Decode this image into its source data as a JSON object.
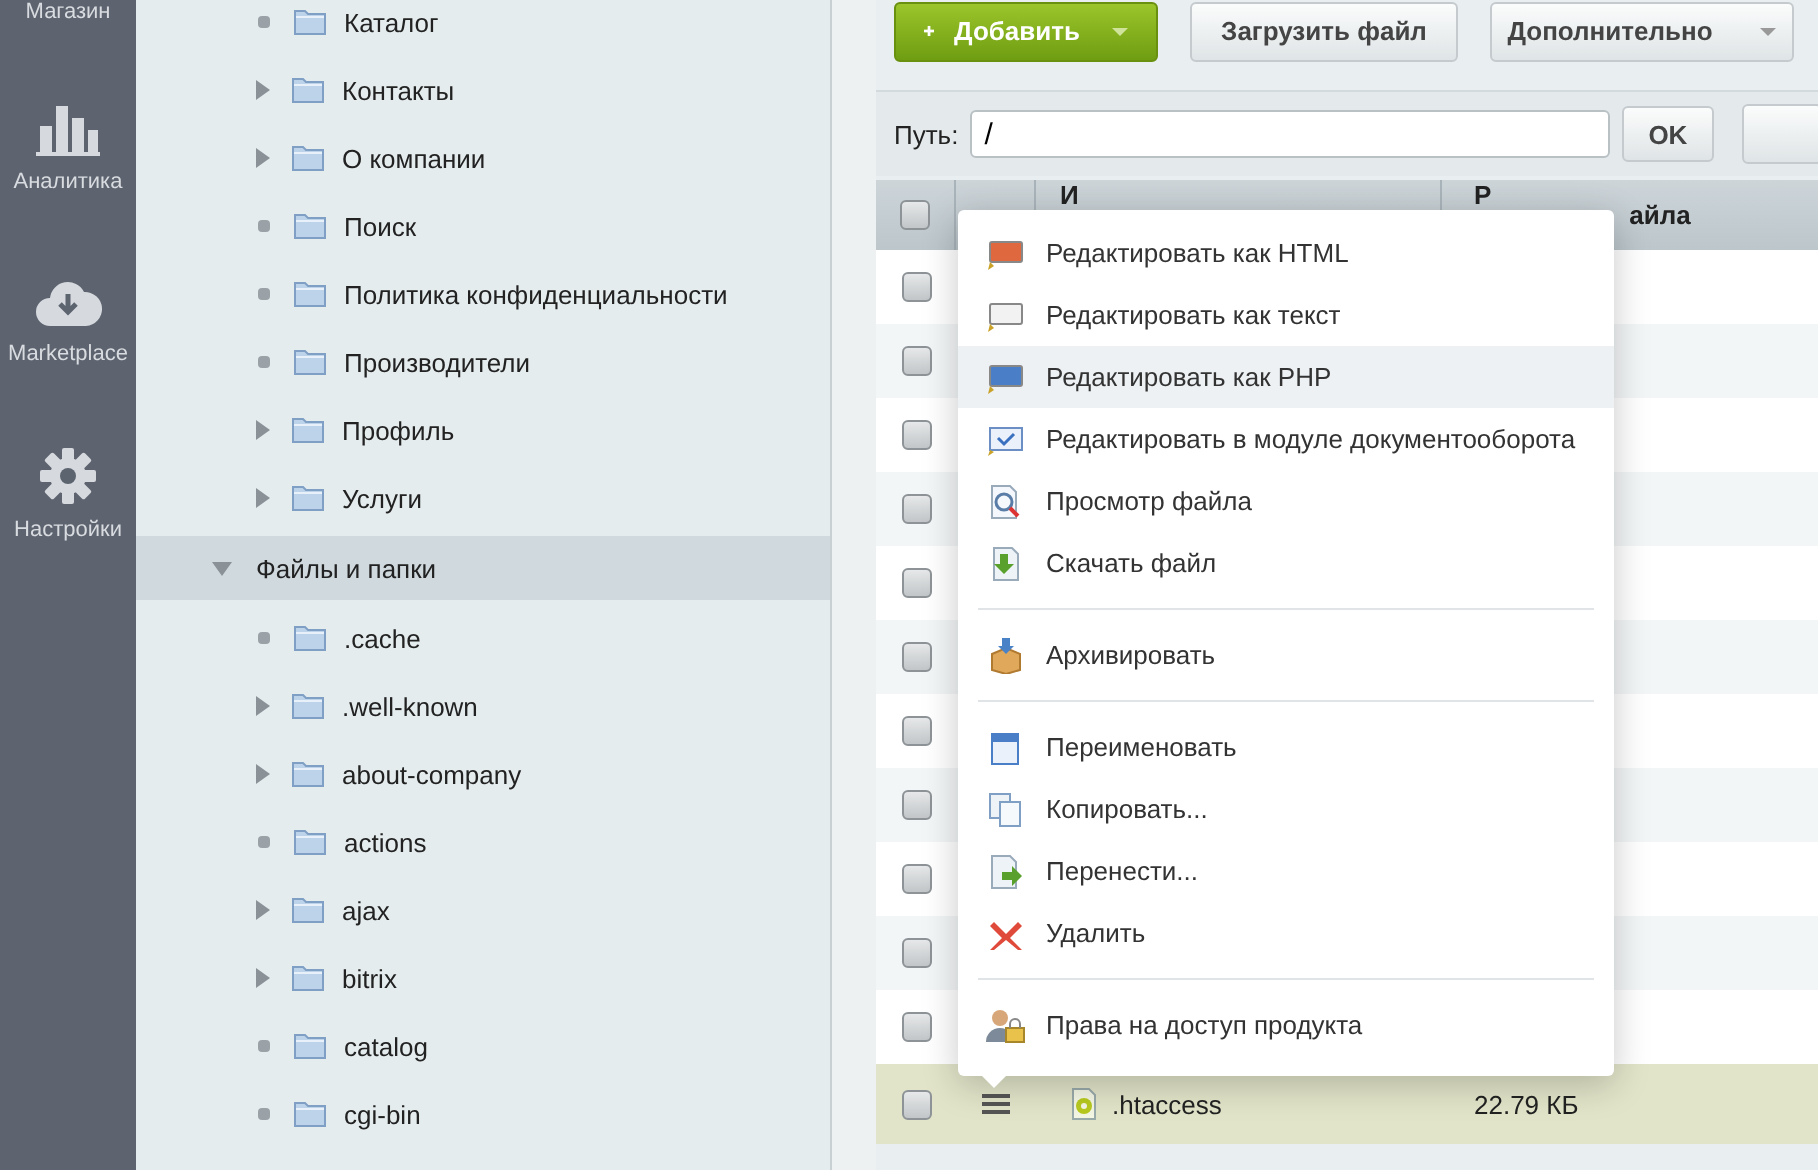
{
  "nav": [
    {
      "label": "Магазин"
    },
    {
      "label": "Аналитика"
    },
    {
      "label": "Marketplace"
    },
    {
      "label": "Настройки"
    }
  ],
  "tree": {
    "branch": [
      {
        "label": "Каталог",
        "expandable": false
      },
      {
        "label": "Контакты",
        "expandable": true
      },
      {
        "label": "О компании",
        "expandable": true
      },
      {
        "label": "Поиск",
        "expandable": false
      },
      {
        "label": "Политика конфиденциальности",
        "expandable": false
      },
      {
        "label": "Производители",
        "expandable": false
      },
      {
        "label": "Профиль",
        "expandable": true
      },
      {
        "label": "Услуги",
        "expandable": true
      }
    ],
    "items": [
      {
        "label": "Файлы и папки",
        "expanded": true,
        "selected": true,
        "children": [
          {
            "label": ".cache",
            "expandable": false
          },
          {
            "label": ".well-known",
            "expandable": true
          },
          {
            "label": "about-company",
            "expandable": true
          },
          {
            "label": "actions",
            "expandable": false
          },
          {
            "label": "ajax",
            "expandable": true
          },
          {
            "label": "bitrix",
            "expandable": true
          },
          {
            "label": "catalog",
            "expandable": false
          },
          {
            "label": "cgi-bin",
            "expandable": false
          }
        ]
      }
    ]
  },
  "toolbar": {
    "add_button": "Добавить",
    "upload_button": "Загрузить файл",
    "more_button": "Дополнительно"
  },
  "path_bar": {
    "label": "Путь:",
    "value": "/",
    "ok_button": "OK"
  },
  "table": {
    "all_checked": false,
    "columns": [
      {
        "text": "И"
      },
      {
        "text": "Р",
        "tail": "айла"
      }
    ],
    "rows": [
      {
        "checked": false,
        "selected": false
      },
      {
        "checked": false,
        "selected": false
      },
      {
        "checked": false,
        "selected": false
      },
      {
        "checked": false,
        "selected": false
      },
      {
        "checked": false,
        "selected": false
      },
      {
        "checked": false,
        "selected": false
      },
      {
        "checked": false,
        "selected": false
      },
      {
        "checked": false,
        "selected": false
      },
      {
        "checked": false,
        "selected": false
      },
      {
        "checked": false,
        "selected": false
      },
      {
        "checked": false,
        "selected": false
      },
      {
        "checked": false,
        "selected": true,
        "name": ".htaccess",
        "size": "22.79 КБ"
      }
    ]
  },
  "context_menu": {
    "groups": [
      [
        {
          "kind": "html",
          "label": "Редактировать как HTML",
          "selected": false
        },
        {
          "kind": "txt",
          "label": "Редактировать как текст",
          "selected": false
        },
        {
          "kind": "php",
          "label": "Редактировать как PHP",
          "selected": true
        },
        {
          "kind": "workflow",
          "label": "Редактировать в модуле документооборота",
          "selected": false
        },
        {
          "kind": "view",
          "label": "Просмотр файла",
          "selected": false
        },
        {
          "kind": "download",
          "label": "Скачать файл",
          "selected": false
        }
      ],
      [
        {
          "kind": "archive",
          "label": "Архивировать",
          "selected": false
        }
      ],
      [
        {
          "kind": "rename",
          "label": "Переименовать",
          "selected": false
        },
        {
          "kind": "copy",
          "label": "Копировать...",
          "selected": false
        },
        {
          "kind": "move",
          "label": "Перенести...",
          "selected": false
        },
        {
          "kind": "delete",
          "label": "Удалить",
          "selected": false
        }
      ],
      [
        {
          "kind": "access",
          "label": "Права на доступ продукта",
          "selected": false
        }
      ]
    ]
  }
}
